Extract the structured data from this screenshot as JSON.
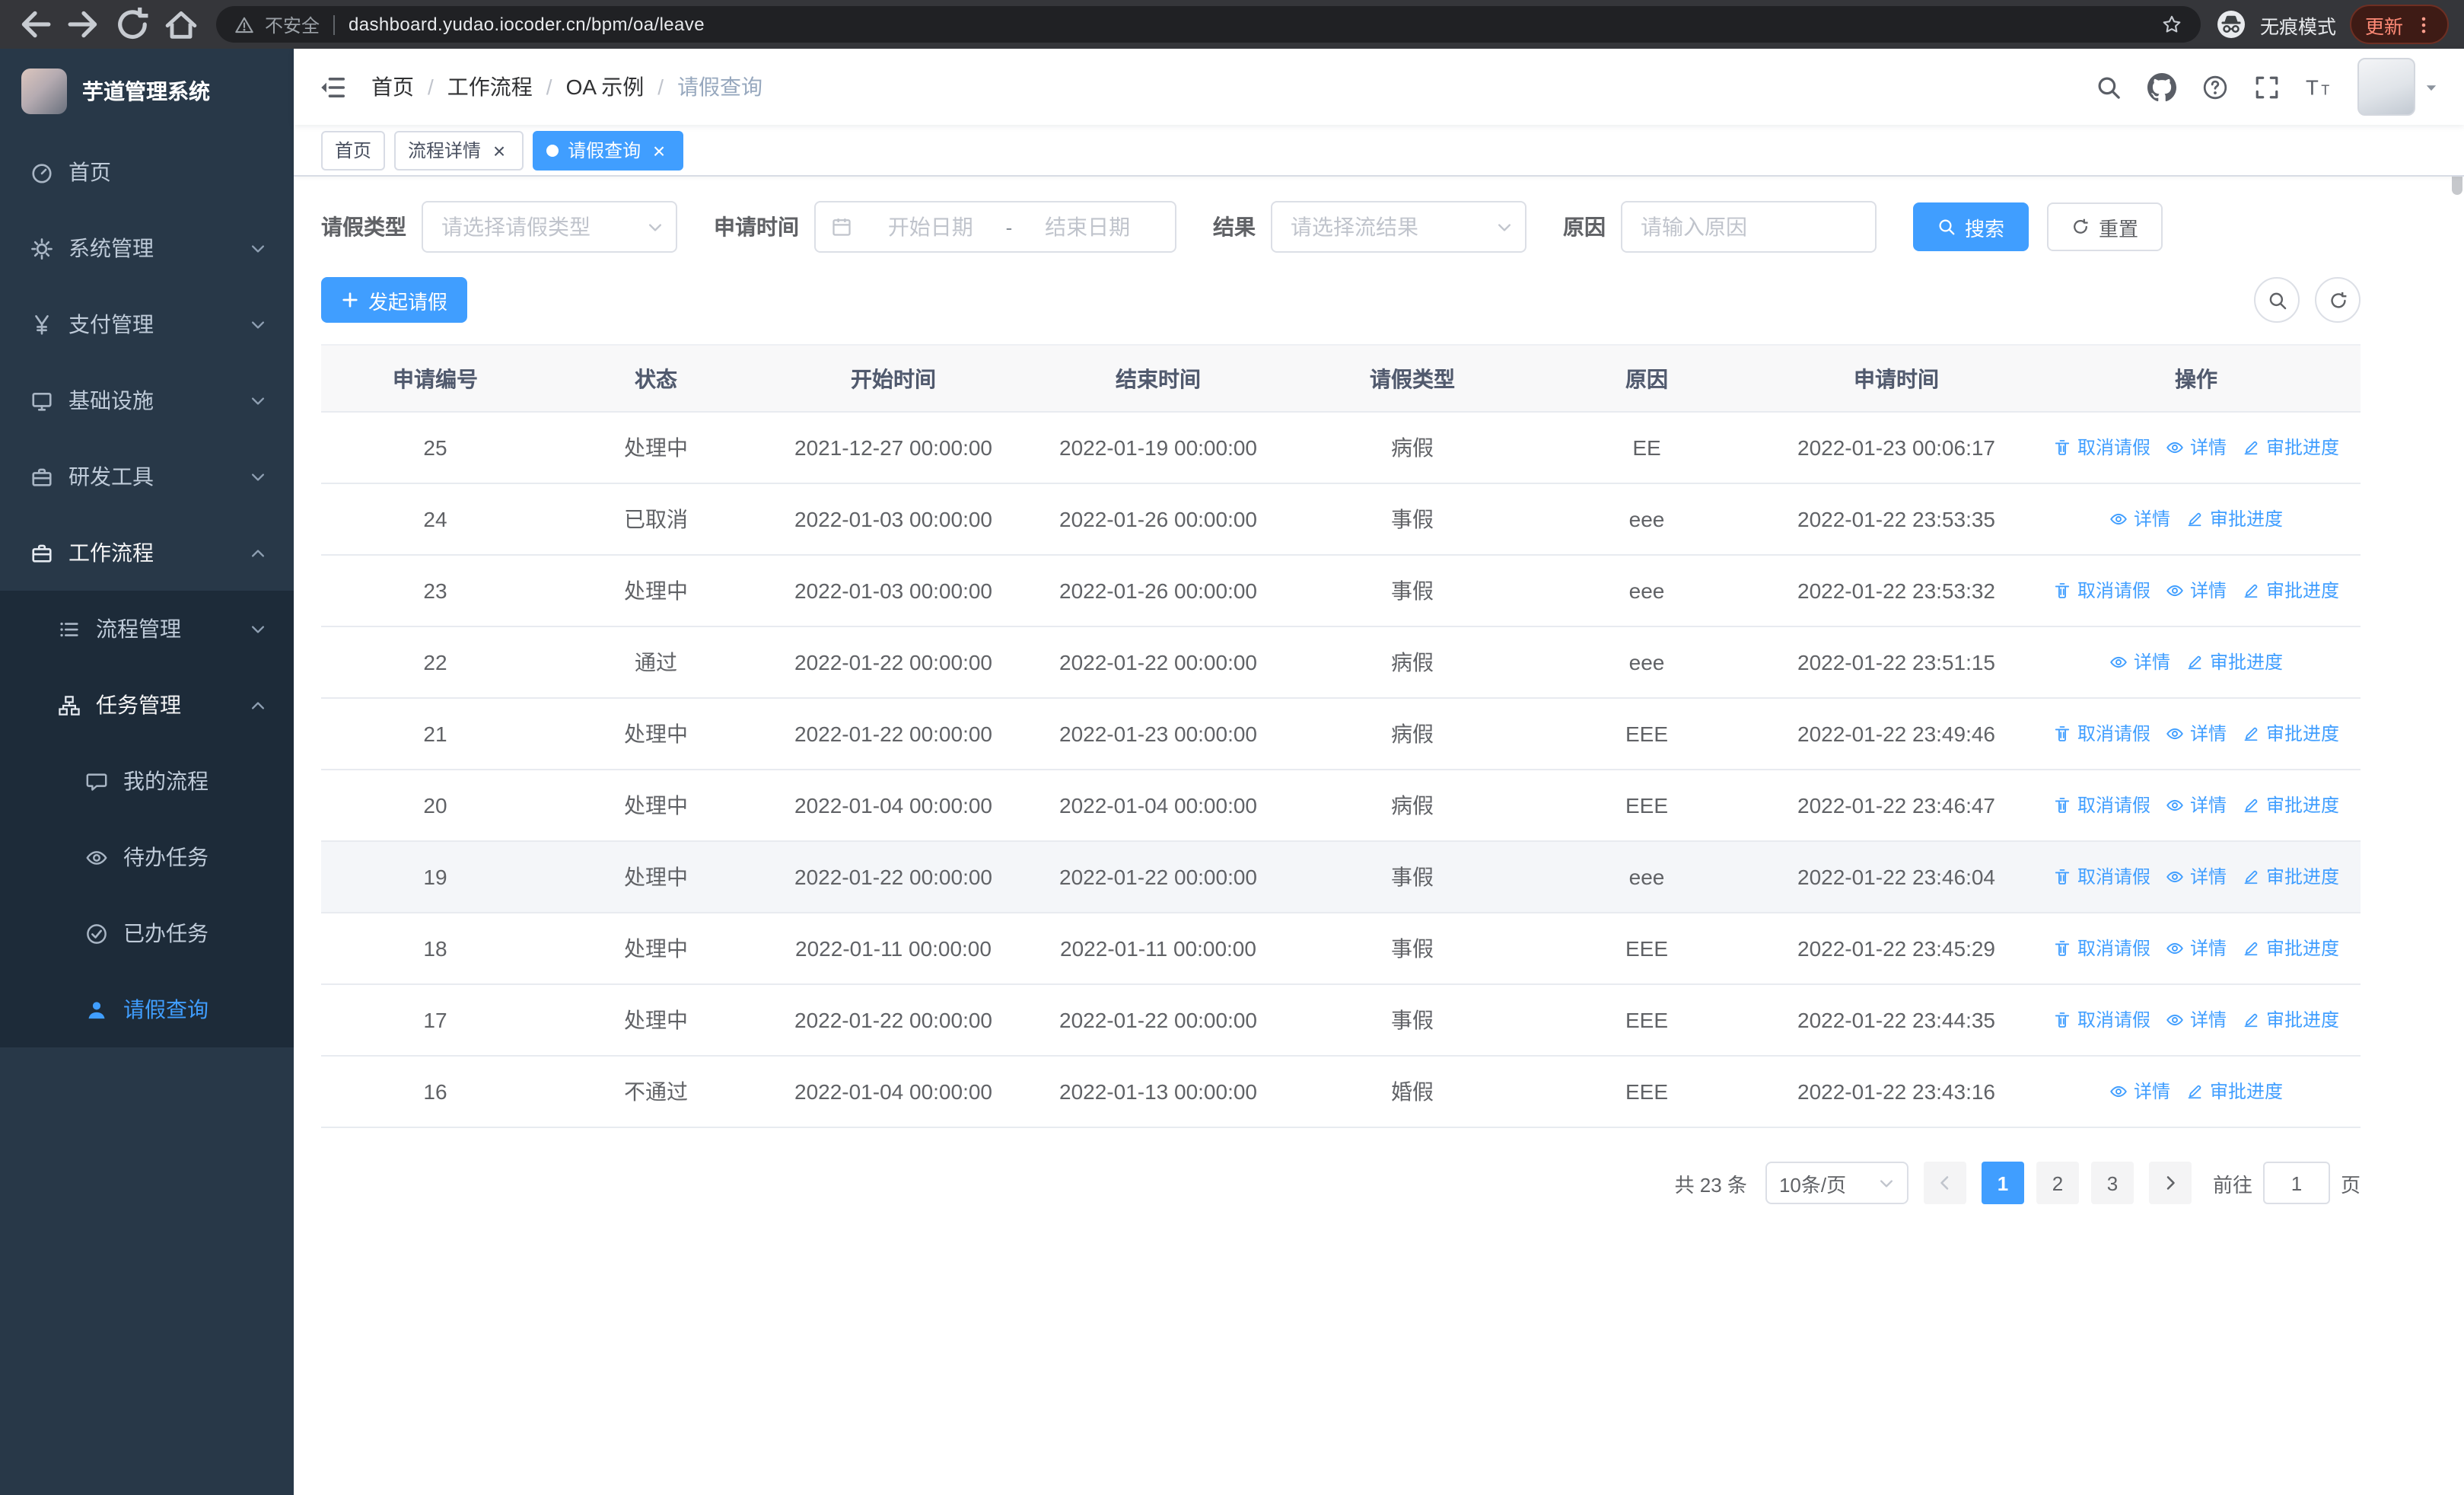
{
  "browser": {
    "security_warning": "不安全",
    "url": "dashboard.yudao.iocoder.cn/bpm/oa/leave",
    "incognito_label": "无痕模式",
    "update_label": "更新"
  },
  "sidebar": {
    "logo_title": "芋道管理系统",
    "items": [
      {
        "key": "home",
        "icon": "dashboard",
        "label": "首页",
        "depth": 0,
        "arrow": null,
        "sub": false,
        "active": false,
        "open": false
      },
      {
        "key": "system",
        "icon": "gear",
        "label": "系统管理",
        "depth": 0,
        "arrow": "down",
        "sub": false,
        "active": false,
        "open": false
      },
      {
        "key": "payment",
        "icon": "yen",
        "label": "支付管理",
        "depth": 0,
        "arrow": "down",
        "sub": false,
        "active": false,
        "open": false
      },
      {
        "key": "infra",
        "icon": "monitor",
        "label": "基础设施",
        "depth": 0,
        "arrow": "down",
        "sub": false,
        "active": false,
        "open": false
      },
      {
        "key": "devtool",
        "icon": "briefcase",
        "label": "研发工具",
        "depth": 0,
        "arrow": "down",
        "sub": false,
        "active": false,
        "open": false
      },
      {
        "key": "workflow",
        "icon": "briefcase",
        "label": "工作流程",
        "depth": 0,
        "arrow": "up",
        "sub": false,
        "active": false,
        "open": true
      },
      {
        "key": "process-mgmt",
        "icon": "list",
        "label": "流程管理",
        "depth": 1,
        "arrow": "down",
        "sub": true,
        "active": false,
        "open": false
      },
      {
        "key": "task-mgmt",
        "icon": "tree",
        "label": "任务管理",
        "depth": 1,
        "arrow": "up",
        "sub": true,
        "active": false,
        "open": true
      },
      {
        "key": "my-process",
        "icon": "chat",
        "label": "我的流程",
        "depth": 2,
        "arrow": null,
        "sub": true,
        "active": false,
        "open": false
      },
      {
        "key": "todo-task",
        "icon": "eye",
        "label": "待办任务",
        "depth": 2,
        "arrow": null,
        "sub": true,
        "active": false,
        "open": false
      },
      {
        "key": "done-task",
        "icon": "check",
        "label": "已办任务",
        "depth": 2,
        "arrow": null,
        "sub": true,
        "active": false,
        "open": false
      },
      {
        "key": "leave-query",
        "icon": "user",
        "label": "请假查询",
        "depth": 2,
        "arrow": null,
        "sub": true,
        "active": true,
        "open": false
      }
    ]
  },
  "navbar": {
    "breadcrumb": [
      "首页",
      "工作流程",
      "OA 示例",
      "请假查询"
    ],
    "separator": "/"
  },
  "tabs": [
    {
      "key": "home",
      "label": "首页",
      "active": false,
      "closable": false
    },
    {
      "key": "process-detail",
      "label": "流程详情",
      "active": false,
      "closable": true
    },
    {
      "key": "leave-query",
      "label": "请假查询",
      "active": true,
      "closable": true
    }
  ],
  "filters": {
    "leave_type_label": "请假类型",
    "leave_type_placeholder": "请选择请假类型",
    "apply_time_label": "申请时间",
    "start_date_placeholder": "开始日期",
    "range_separator": "-",
    "end_date_placeholder": "结束日期",
    "result_label": "结果",
    "result_placeholder": "请选择流结果",
    "reason_label": "原因",
    "reason_placeholder": "请输入原因",
    "search_button": "搜索",
    "reset_button": "重置"
  },
  "toolbar": {
    "create_button": "发起请假"
  },
  "table": {
    "columns": [
      "申请编号",
      "状态",
      "开始时间",
      "结束时间",
      "请假类型",
      "原因",
      "申请时间",
      "操作"
    ],
    "action_labels": {
      "cancel": "取消请假",
      "detail": "详情",
      "progress": "审批进度"
    },
    "rows": [
      {
        "id": "25",
        "status": "处理中",
        "start": "2021-12-27 00:00:00",
        "end": "2022-01-19 00:00:00",
        "type": "病假",
        "reason": "EE",
        "applied": "2022-01-23 00:06:17",
        "actions": [
          "cancel",
          "detail",
          "progress"
        ],
        "highlight": false
      },
      {
        "id": "24",
        "status": "已取消",
        "start": "2022-01-03 00:00:00",
        "end": "2022-01-26 00:00:00",
        "type": "事假",
        "reason": "eee",
        "applied": "2022-01-22 23:53:35",
        "actions": [
          "detail",
          "progress"
        ],
        "highlight": false
      },
      {
        "id": "23",
        "status": "处理中",
        "start": "2022-01-03 00:00:00",
        "end": "2022-01-26 00:00:00",
        "type": "事假",
        "reason": "eee",
        "applied": "2022-01-22 23:53:32",
        "actions": [
          "cancel",
          "detail",
          "progress"
        ],
        "highlight": false
      },
      {
        "id": "22",
        "status": "通过",
        "start": "2022-01-22 00:00:00",
        "end": "2022-01-22 00:00:00",
        "type": "病假",
        "reason": "eee",
        "applied": "2022-01-22 23:51:15",
        "actions": [
          "detail",
          "progress"
        ],
        "highlight": false
      },
      {
        "id": "21",
        "status": "处理中",
        "start": "2022-01-22 00:00:00",
        "end": "2022-01-23 00:00:00",
        "type": "病假",
        "reason": "EEE",
        "applied": "2022-01-22 23:49:46",
        "actions": [
          "cancel",
          "detail",
          "progress"
        ],
        "highlight": false
      },
      {
        "id": "20",
        "status": "处理中",
        "start": "2022-01-04 00:00:00",
        "end": "2022-01-04 00:00:00",
        "type": "病假",
        "reason": "EEE",
        "applied": "2022-01-22 23:46:47",
        "actions": [
          "cancel",
          "detail",
          "progress"
        ],
        "highlight": false
      },
      {
        "id": "19",
        "status": "处理中",
        "start": "2022-01-22 00:00:00",
        "end": "2022-01-22 00:00:00",
        "type": "事假",
        "reason": "eee",
        "applied": "2022-01-22 23:46:04",
        "actions": [
          "cancel",
          "detail",
          "progress"
        ],
        "highlight": true
      },
      {
        "id": "18",
        "status": "处理中",
        "start": "2022-01-11 00:00:00",
        "end": "2022-01-11 00:00:00",
        "type": "事假",
        "reason": "EEE",
        "applied": "2022-01-22 23:45:29",
        "actions": [
          "cancel",
          "detail",
          "progress"
        ],
        "highlight": false
      },
      {
        "id": "17",
        "status": "处理中",
        "start": "2022-01-22 00:00:00",
        "end": "2022-01-22 00:00:00",
        "type": "事假",
        "reason": "EEE",
        "applied": "2022-01-22 23:44:35",
        "actions": [
          "cancel",
          "detail",
          "progress"
        ],
        "highlight": false
      },
      {
        "id": "16",
        "status": "不通过",
        "start": "2022-01-04 00:00:00",
        "end": "2022-01-13 00:00:00",
        "type": "婚假",
        "reason": "EEE",
        "applied": "2022-01-22 23:43:16",
        "actions": [
          "detail",
          "progress"
        ],
        "highlight": false
      }
    ]
  },
  "pagination": {
    "total": "共 23 条",
    "page_size": "10条/页",
    "pages": [
      "1",
      "2",
      "3"
    ],
    "active_page": "1",
    "goto_label": "前往",
    "goto_value": "1",
    "goto_suffix": "页"
  },
  "icons": {
    "search": "magnifier",
    "refresh": "circular-arrow",
    "delete": "trash",
    "eye": "eye",
    "edit": "pen",
    "plus": "+",
    "calendar": "calendar",
    "github": "octocat",
    "question": "?",
    "fullscreen": "corners",
    "fontsize": "TT",
    "incognito": "spy-hat",
    "warning": "⚠",
    "star": "☆",
    "dots": "⋮",
    "close": "×"
  },
  "colors": {
    "primary": "#409EFF",
    "sidebar_bg": "#283848",
    "sidebar_submenu_bg": "#1d2b39",
    "sidebar_text": "#bfcbd9",
    "table_header_bg": "#f8f8f9",
    "link": "#409EFF",
    "chrome_bar": "#35363a",
    "omnibox": "#202124",
    "update_pill_text": "#ff8a76"
  }
}
